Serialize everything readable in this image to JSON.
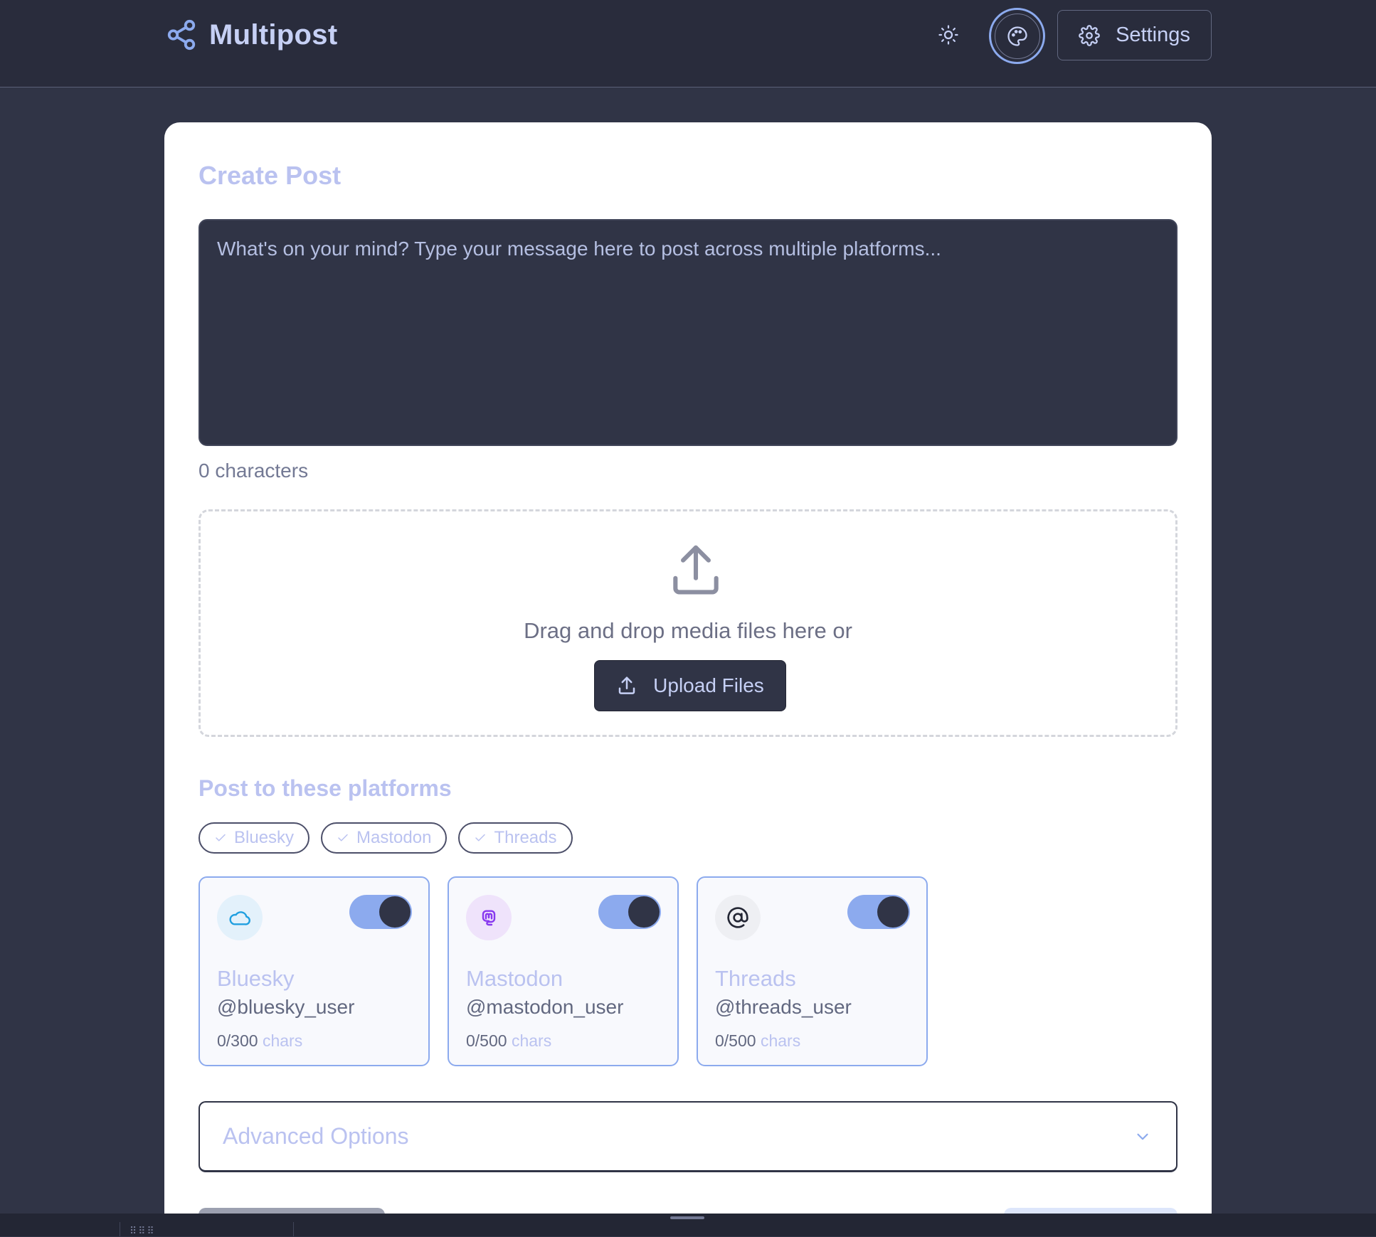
{
  "header": {
    "brand_name": "Multipost",
    "settings_label": "Settings"
  },
  "composer": {
    "title": "Create Post",
    "placeholder": "What's on your mind? Type your message here to post across multiple platforms...",
    "char_count": "0 characters"
  },
  "media": {
    "drop_text": "Drag and drop media files here or",
    "upload_label": "Upload Files"
  },
  "platforms": {
    "section_title": "Post to these platforms",
    "chips": [
      "Bluesky",
      "Mastodon",
      "Threads"
    ],
    "cards": [
      {
        "name": "Bluesky",
        "handle": "@bluesky_user",
        "count": "0/300",
        "unit": "chars",
        "enabled": true,
        "icon": "cloud-icon",
        "icon_color": "#209fe0",
        "icon_bg": "#e3f1fb"
      },
      {
        "name": "Mastodon",
        "handle": "@mastodon_user",
        "count": "0/500",
        "unit": "chars",
        "enabled": true,
        "icon": "mastodon-icon",
        "icon_color": "#8839ef",
        "icon_bg": "#efe3fb"
      },
      {
        "name": "Threads",
        "handle": "@threads_user",
        "count": "0/500",
        "unit": "chars",
        "enabled": true,
        "icon": "at-sign-icon",
        "icon_color": "#232634",
        "icon_bg": "#eeeff3"
      }
    ]
  },
  "advanced": {
    "label": "Advanced Options"
  },
  "bottom_bar": {
    "dots": "⠿⠿⠿"
  },
  "colors": {
    "accent": "#8caaee",
    "background": "#303446",
    "header": "#292c3c",
    "card": "#ffffff",
    "muted_text": "#bac2f0"
  }
}
